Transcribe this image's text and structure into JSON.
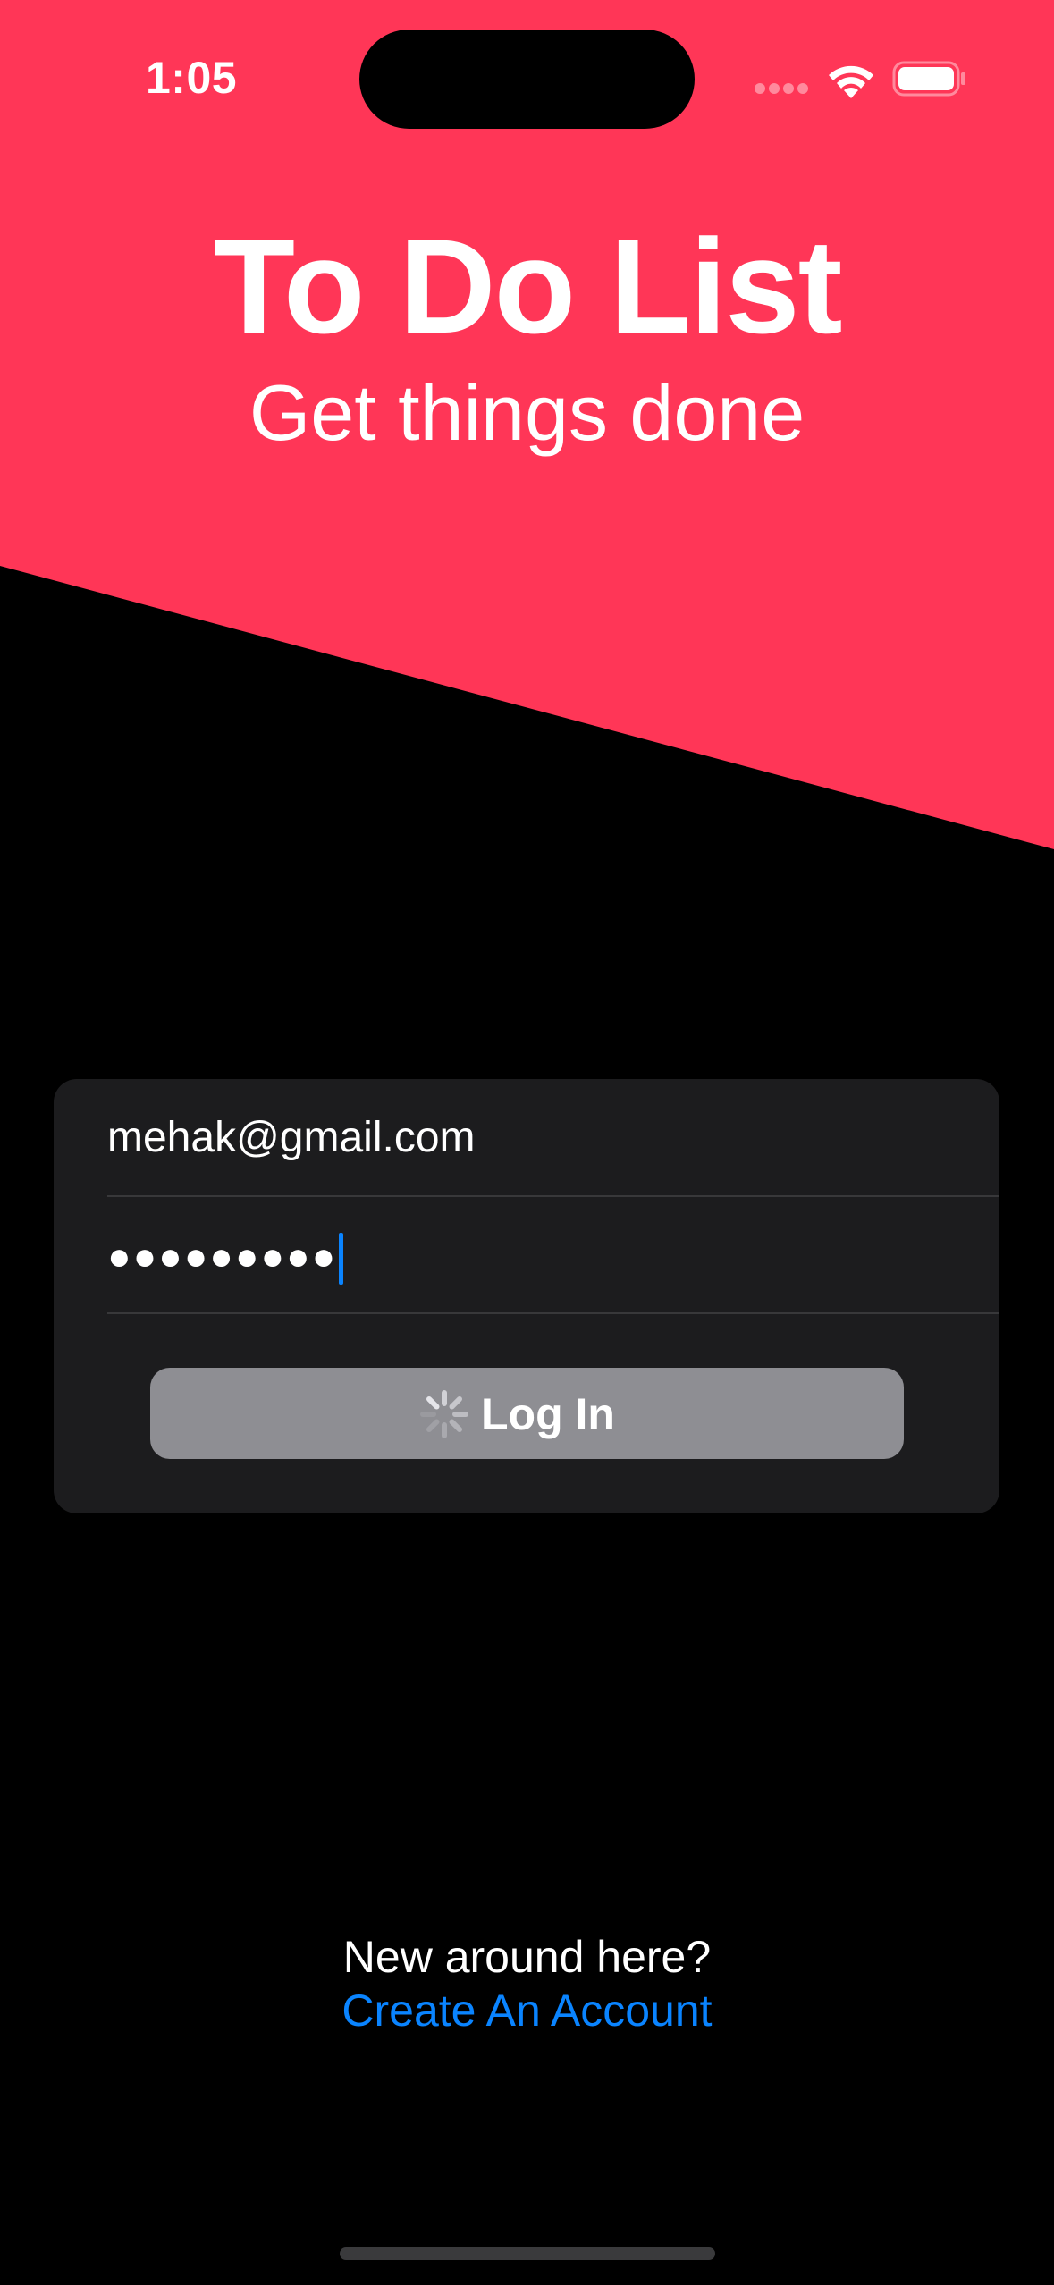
{
  "status_bar": {
    "time": "1:05",
    "icons": [
      "signal-icon",
      "wifi-icon",
      "battery-icon"
    ]
  },
  "header": {
    "title": "To Do List",
    "subtitle": "Get things done",
    "background_color": "#ff3657"
  },
  "login_form": {
    "email_value": "mehak@gmail.com",
    "password_value": "●●●●●●●●●",
    "login_button_label": "Log In",
    "button_state": "loading",
    "button_color": "#8e8e93"
  },
  "footer": {
    "prompt_text": "New around here?",
    "create_account_label": "Create An Account",
    "link_color": "#0a84ff"
  }
}
